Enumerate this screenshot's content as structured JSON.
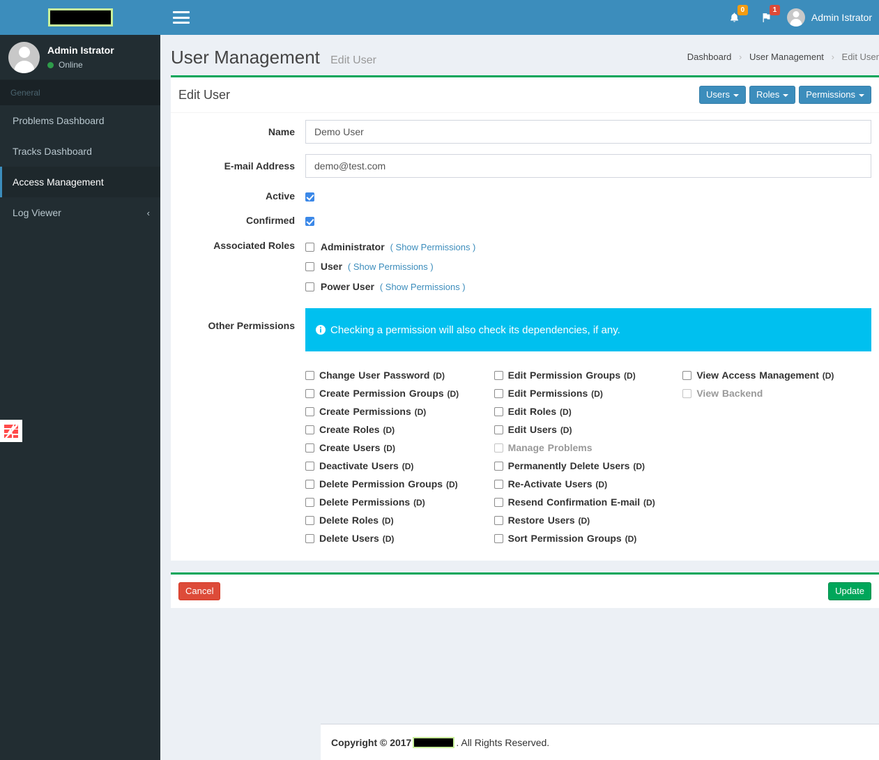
{
  "brand": {
    "logo_redacted": true,
    "header_color": "#3c8dbc",
    "accent_green": "#00a65a",
    "info_cyan": "#00c0ef"
  },
  "navbar": {
    "menu_toggle": "hamburger-icon",
    "notifications": {
      "icon": "bell-icon",
      "count": "0"
    },
    "flags": {
      "icon": "flag-icon",
      "count": "1"
    },
    "user_name": "Admin Istrator"
  },
  "sidebar": {
    "user": {
      "name": "Admin Istrator",
      "status": "Online"
    },
    "section_header": "General",
    "items": [
      {
        "label": "Problems Dashboard",
        "active": false,
        "chevron": ""
      },
      {
        "label": "Tracks Dashboard",
        "active": false,
        "chevron": ""
      },
      {
        "label": "Access Management",
        "active": true,
        "chevron": ""
      },
      {
        "label": "Log Viewer",
        "active": false,
        "chevron": "‹"
      }
    ]
  },
  "page": {
    "title": "User Management",
    "subtitle": "Edit User",
    "breadcrumb": [
      {
        "label": "Dashboard",
        "current": false
      },
      {
        "label": "User Management",
        "current": false
      },
      {
        "label": "Edit User",
        "current": true
      }
    ],
    "breadcrumb_separator": "›"
  },
  "box": {
    "title": "Edit User",
    "tools": [
      {
        "label": "Users"
      },
      {
        "label": "Roles"
      },
      {
        "label": "Permissions"
      }
    ]
  },
  "form": {
    "name": {
      "label": "Name",
      "value": "Demo User",
      "placeholder": "Name"
    },
    "email": {
      "label": "E-mail Address",
      "value": "demo@test.com",
      "placeholder": "E-mail Address"
    },
    "active": {
      "label": "Active",
      "checked": true
    },
    "confirmed": {
      "label": "Confirmed",
      "checked": true
    },
    "associated_roles": {
      "label": "Associated Roles",
      "link_text": "( Show Permissions )",
      "roles": [
        {
          "name": "Administrator",
          "checked": false
        },
        {
          "name": "User",
          "checked": false
        },
        {
          "name": "Power User",
          "checked": false
        }
      ]
    },
    "other_permissions": {
      "label": "Other Permissions",
      "info_icon": "info-circle-icon",
      "info_text": "Checking a permission will also check its dependencies, if any.",
      "columns": [
        [
          {
            "name": "Change User Password",
            "suffix": "(D)",
            "checked": false,
            "muted": false
          },
          {
            "name": "Create Permission Groups",
            "suffix": "(D)",
            "checked": false,
            "muted": false
          },
          {
            "name": "Create Permissions",
            "suffix": "(D)",
            "checked": false,
            "muted": false
          },
          {
            "name": "Create Roles",
            "suffix": "(D)",
            "checked": false,
            "muted": false
          },
          {
            "name": "Create Users",
            "suffix": "(D)",
            "checked": false,
            "muted": false
          },
          {
            "name": "Deactivate Users",
            "suffix": "(D)",
            "checked": false,
            "muted": false
          },
          {
            "name": "Delete Permission Groups",
            "suffix": "(D)",
            "checked": false,
            "muted": false
          },
          {
            "name": "Delete Permissions",
            "suffix": "(D)",
            "checked": false,
            "muted": false
          },
          {
            "name": "Delete Roles",
            "suffix": "(D)",
            "checked": false,
            "muted": false
          },
          {
            "name": "Delete Users",
            "suffix": "(D)",
            "checked": false,
            "muted": false
          }
        ],
        [
          {
            "name": "Edit Permission Groups",
            "suffix": "(D)",
            "checked": false,
            "muted": false
          },
          {
            "name": "Edit Permissions",
            "suffix": "(D)",
            "checked": false,
            "muted": false
          },
          {
            "name": "Edit Roles",
            "suffix": "(D)",
            "checked": false,
            "muted": false
          },
          {
            "name": "Edit Users",
            "suffix": "(D)",
            "checked": false,
            "muted": false
          },
          {
            "name": "Manage Problems",
            "suffix": "",
            "checked": false,
            "muted": true
          },
          {
            "name": "Permanently Delete Users",
            "suffix": "(D)",
            "checked": false,
            "muted": false
          },
          {
            "name": "Re-Activate Users",
            "suffix": "(D)",
            "checked": false,
            "muted": false
          },
          {
            "name": "Resend Confirmation E-mail",
            "suffix": "(D)",
            "checked": false,
            "muted": false
          },
          {
            "name": "Restore Users",
            "suffix": "(D)",
            "checked": false,
            "muted": false
          },
          {
            "name": "Sort Permission Groups",
            "suffix": "(D)",
            "checked": false,
            "muted": false
          }
        ],
        [
          {
            "name": "View Access Management",
            "suffix": "(D)",
            "checked": false,
            "muted": false
          },
          {
            "name": "View Backend",
            "suffix": "",
            "checked": false,
            "muted": true
          }
        ]
      ]
    }
  },
  "actions": {
    "cancel": "Cancel",
    "update": "Update"
  },
  "footer": {
    "prefix": "Copyright © 2017",
    "company_redacted": true,
    "suffix": ". All Rights Reserved."
  }
}
